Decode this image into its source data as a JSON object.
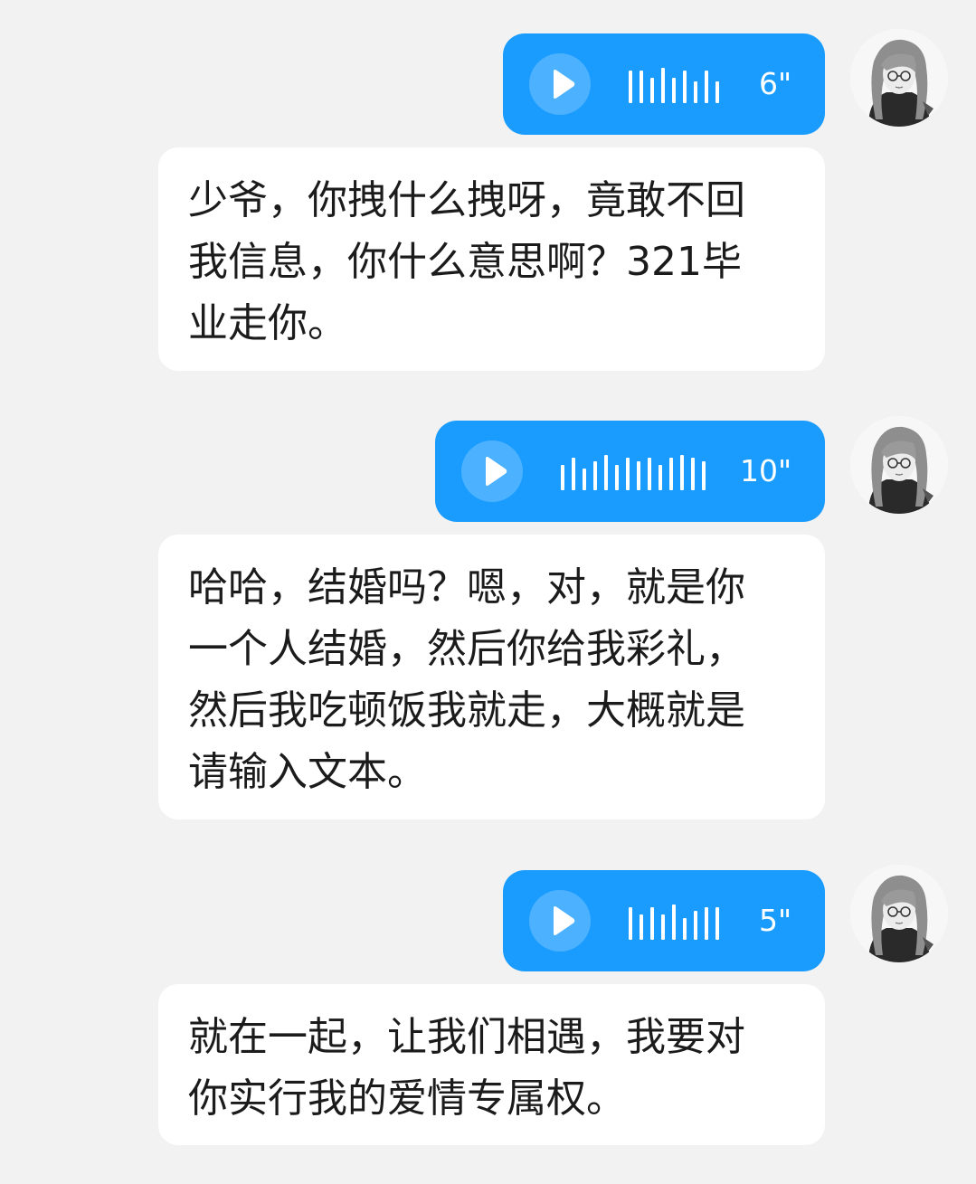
{
  "colors": {
    "background": "#f2f2f2",
    "voice_bubble": "#1a9cff",
    "text_bubble": "#ffffff",
    "text": "#1b1b1b"
  },
  "messages": [
    {
      "voice": {
        "duration": "6\"",
        "icon": "play-icon"
      },
      "text_lines": [
        "少爷，你拽什么拽呀，竟敢不回",
        "我信息，你什么意思啊？321毕",
        "业走你。"
      ]
    },
    {
      "voice": {
        "duration": "10\"",
        "icon": "play-icon"
      },
      "text_lines": [
        "哈哈，结婚吗？嗯，对，就是你",
        "一个人结婚，然后你给我彩礼，",
        "然后我吃顿饭我就走，大概就是",
        "请输入文本。"
      ]
    },
    {
      "voice": {
        "duration": "5\"",
        "icon": "play-icon"
      },
      "text_lines": [
        "就在一起，让我们相遇，我要对",
        "你实行我的爱情专属权。"
      ]
    }
  ],
  "avatar": {
    "icon": "avatar-anime-girl-icon"
  }
}
